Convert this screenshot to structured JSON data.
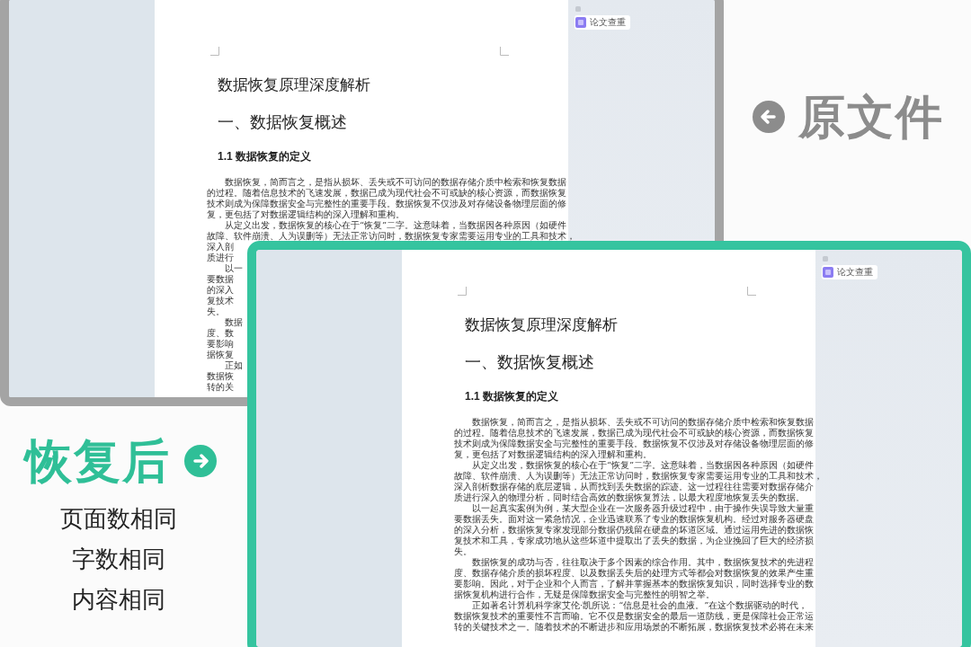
{
  "windows": [
    {
      "kind": "original",
      "paper": {
        "title": "数据恢复原理深度解析",
        "heading": "一、数据恢复概述",
        "subheading": "1.1  数据恢复的定义",
        "lines": [
          {
            "text": "数据恢复，简而言之，是指从损坏、丢失或不可访问的数据存储介质中检索和恢复数据",
            "indent": true
          },
          {
            "text": "的过程。随着信息技术的飞速发展，数据已成为现代社会不可或缺的核心资源，而数据恢复",
            "indent": false
          },
          {
            "text": "技术则成为保障数据安全与完整性的重要手段。数据恢复不仅涉及对存储设备物理层面的修",
            "indent": false
          },
          {
            "text": "复，更包括了对数据逻辑结构的深入理解和重构。",
            "indent": false
          },
          {
            "text": "从定义出发，数据恢复的核心在于“恢复”二字。这意味着，当数据因各种原因（如硬件",
            "indent": true
          },
          {
            "text": "故障、软件崩溃、人为误删等）无法正常访问时，数据恢复专家需要运用专业的工具和技术，",
            "indent": false
          },
          {
            "text": "深入剖",
            "indent": false
          },
          {
            "text": "质进行",
            "indent": false
          },
          {
            "text": "以一",
            "indent": true
          },
          {
            "text": "要数据",
            "indent": false
          },
          {
            "text": "的深入",
            "indent": false
          },
          {
            "text": "复技术",
            "indent": false
          },
          {
            "text": "失。",
            "indent": false
          },
          {
            "text": "数据",
            "indent": true
          },
          {
            "text": "度、数",
            "indent": false
          },
          {
            "text": "要影响",
            "indent": false
          },
          {
            "text": "据恢复",
            "indent": false
          },
          {
            "text": "正如",
            "indent": true
          },
          {
            "text": "数据恢",
            "indent": false
          },
          {
            "text": "转的关",
            "indent": false
          }
        ]
      },
      "side_button": "论文查重"
    },
    {
      "kind": "restored",
      "paper": {
        "title": "数据恢复原理深度解析",
        "heading": "一、数据恢复概述",
        "subheading": "1.1  数据恢复的定义",
        "lines": [
          {
            "text": "数据恢复，简而言之，是指从损坏、丢失或不可访问的数据存储介质中检索和恢复数据",
            "indent": true
          },
          {
            "text": "的过程。随着信息技术的飞速发展，数据已成为现代社会不可或缺的核心资源，而数据恢复",
            "indent": false
          },
          {
            "text": "技术则成为保障数据安全与完整性的重要手段。数据恢复不仅涉及对存储设备物理层面的修",
            "indent": false
          },
          {
            "text": "复，更包括了对数据逻辑结构的深入理解和重构。",
            "indent": false
          },
          {
            "text": "从定义出发，数据恢复的核心在于“恢复”二字。这意味着，当数据因各种原因（如硬件",
            "indent": true
          },
          {
            "text": "故障、软件崩溃、人为误删等）无法正常访问时，数据恢复专家需要运用专业的工具和技术，",
            "indent": false
          },
          {
            "text": "深入剖析数据存储的底层逻辑，从而找到丢失数据的踪迹。这一过程往往需要对数据存储介",
            "indent": false
          },
          {
            "text": "质进行深入的物理分析，同时结合高效的数据恢复算法，以最大程度地恢复丢失的数据。",
            "indent": false
          },
          {
            "text": "以一起真实案例为例，某大型企业在一次服务器升级过程中，由于操作失误导致大量重",
            "indent": true
          },
          {
            "text": "要数据丢失。面对这一紧急情况，企业迅速联系了专业的数据恢复机构。经过对服务器硬盘",
            "indent": false
          },
          {
            "text": "的深入分析，数据恢复专家发现部分数据仍残留在硬盘的坏道区域。通过运用先进的数据恢",
            "indent": false
          },
          {
            "text": "复技术和工具，专家成功地从这些坏道中提取出了丢失的数据，为企业挽回了巨大的经济损",
            "indent": false
          },
          {
            "text": "失。",
            "indent": false
          },
          {
            "text": "数据恢复的成功与否，往往取决于多个因素的综合作用。其中，数据恢复技术的先进程",
            "indent": true
          },
          {
            "text": "度、数据存储介质的损坏程度、以及数据丢失后的处理方式等都会对数据恢复的效果产生重",
            "indent": false
          },
          {
            "text": "要影响。因此，对于企业和个人而言，了解并掌握基本的数据恢复知识，同时选择专业的数",
            "indent": false
          },
          {
            "text": "据恢复机构进行合作，无疑是保障数据安全与完整性的明智之举。",
            "indent": false
          },
          {
            "text": "正如著名计算机科学家艾伦·凯所说：“信息是社会的血液。”在这个数据驱动的时代，",
            "indent": true
          },
          {
            "text": "数据恢复技术的重要性不言而喻。它不仅是数据安全的最后一道防线，更是保障社会正常运",
            "indent": false
          },
          {
            "text": "转的关键技术之一。随着技术的不断进步和应用场景的不断拓展，数据恢复技术必将在未来",
            "indent": false
          }
        ]
      },
      "side_button": "论文查重"
    }
  ],
  "labels": {
    "original": "原文件",
    "restored": "恢复后",
    "notes": [
      "页面数相同",
      "字数相同",
      "内容相同"
    ]
  }
}
